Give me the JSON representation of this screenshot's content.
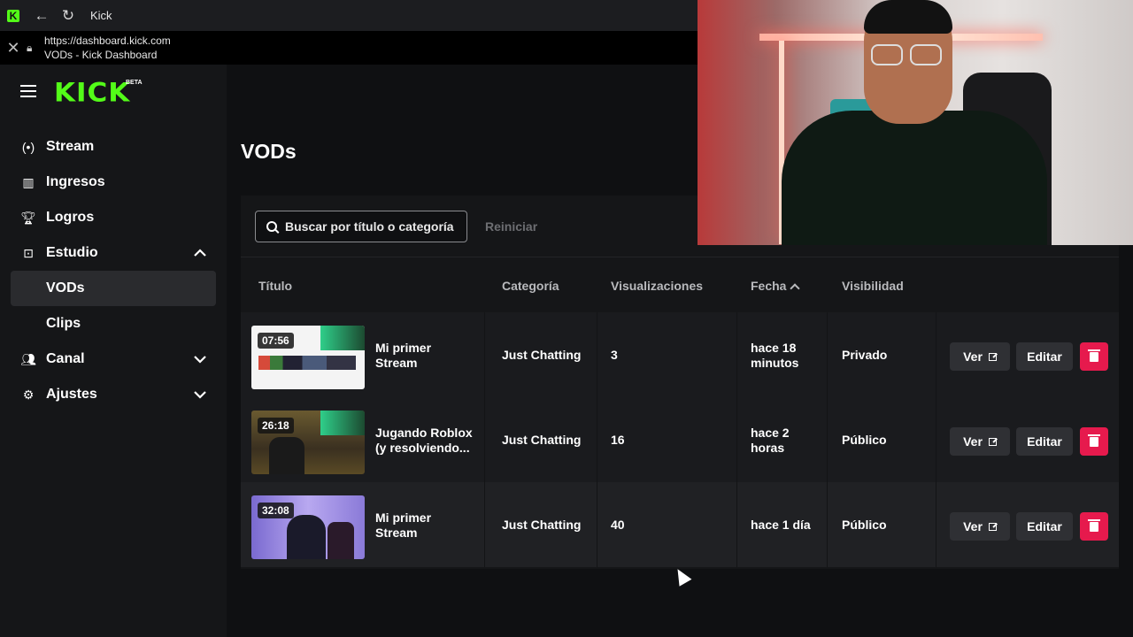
{
  "browser": {
    "tab_title": "Kick",
    "url": "https://dashboard.kick.com",
    "page_title": "VODs - Kick Dashboard"
  },
  "brand": {
    "logo_text": "KICK",
    "badge": "BETA",
    "accent_color": "#53fc18"
  },
  "sidebar": {
    "items": [
      {
        "label": "Stream",
        "icon": "broadcast-icon"
      },
      {
        "label": "Ingresos",
        "icon": "chart-icon"
      },
      {
        "label": "Logros",
        "icon": "trophy-icon"
      },
      {
        "label": "Estudio",
        "icon": "studio-icon",
        "expanded": true
      },
      {
        "label": "VODs",
        "sub": true,
        "active": true
      },
      {
        "label": "Clips",
        "sub": true
      },
      {
        "label": "Canal",
        "icon": "users-icon",
        "expanded": false
      },
      {
        "label": "Ajustes",
        "icon": "gear-icon",
        "expanded": false
      }
    ]
  },
  "main": {
    "title": "VODs",
    "search_placeholder": "Buscar por título o categoría",
    "reset_label": "Reiniciar",
    "columns": [
      "Título",
      "Categoría",
      "Visualizaciones",
      "Fecha",
      "Visibilidad"
    ],
    "rows": [
      {
        "duration": "07:56",
        "title_l1": "Mi primer",
        "title_l2": "Stream",
        "category": "Just Chatting",
        "views": "3",
        "date_l1": "hace 18",
        "date_l2": "minutos",
        "visibility": "Privado"
      },
      {
        "duration": "26:18",
        "title_l1": "Jugando Roblox",
        "title_l2": "(y resolviendo...",
        "category": "Just Chatting",
        "views": "16",
        "date_l1": "hace 2",
        "date_l2": "horas",
        "visibility": "Público"
      },
      {
        "duration": "32:08",
        "title_l1": "Mi primer",
        "title_l2": "Stream",
        "category": "Just Chatting",
        "views": "40",
        "date_l1": "hace 1 día",
        "date_l2": "",
        "visibility": "Público"
      }
    ],
    "actions": {
      "view": "Ver",
      "edit": "Editar",
      "delete_color": "#e61a4d"
    }
  }
}
